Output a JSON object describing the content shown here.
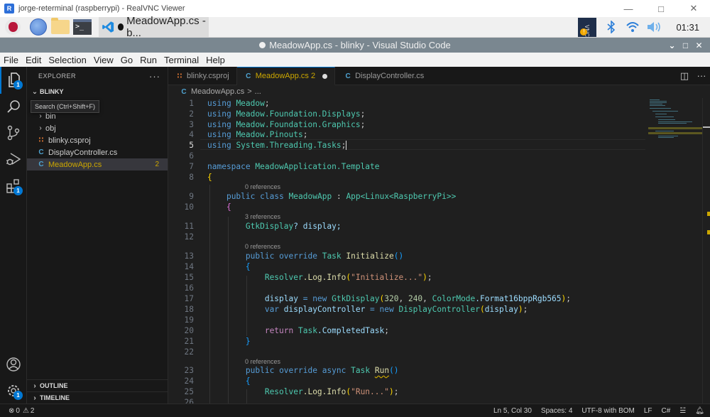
{
  "vnc_window": {
    "title": "jorge-reterminal (raspberrypi) - RealVNC Viewer",
    "controls": [
      "minimize",
      "maximize",
      "close"
    ]
  },
  "taskbar": {
    "launchers": [
      "raspberry-menu",
      "web-browser",
      "file-manager",
      "terminal"
    ],
    "task_label": "MeadowApp.cs - b...",
    "tray": {
      "vnc_label": "VNC",
      "clock": "01:31"
    }
  },
  "vscode": {
    "title": "MeadowApp.cs - blinky - Visual Studio Code",
    "menu": [
      "File",
      "Edit",
      "Selection",
      "View",
      "Go",
      "Run",
      "Terminal",
      "Help"
    ],
    "activity_bar": {
      "explorer_badge": "1",
      "extensions_badge": "1",
      "settings_badge": "1"
    },
    "tooltip": "Search (Ctrl+Shift+F)",
    "sidebar": {
      "header": "EXPLORER",
      "more": "···",
      "root": "BLINKY",
      "items": [
        {
          "label": "bin",
          "type": "folder"
        },
        {
          "label": "obj",
          "type": "folder"
        },
        {
          "label": "blinky.csproj",
          "type": "csproj"
        },
        {
          "label": "DisplayController.cs",
          "type": "cs"
        },
        {
          "label": "MeadowApp.cs",
          "type": "cs",
          "problems": "2",
          "active": true
        }
      ],
      "outline": "OUTLINE",
      "timeline": "TIMELINE"
    },
    "tabs": [
      {
        "label": "blinky.csproj",
        "active": false
      },
      {
        "label": "MeadowApp.cs",
        "problems": "2",
        "active": true,
        "modified": true
      },
      {
        "label": "DisplayController.cs",
        "active": false
      }
    ],
    "breadcrumb": {
      "file": "MeadowApp.cs",
      "sep": ">",
      "rest": "..."
    },
    "codelens": {
      "l9": "0 references",
      "l11": "3 references",
      "l13": "0 references",
      "l23": "0 references"
    },
    "line_numbers": [
      "1",
      "2",
      "3",
      "4",
      "5",
      "6",
      "7",
      "8",
      "9",
      "10",
      "11",
      "12",
      "13",
      "14",
      "15",
      "16",
      "17",
      "18",
      "19",
      "20",
      "21",
      "22",
      "23",
      "24",
      "25",
      "26"
    ],
    "code": {
      "using": "using",
      "ns1": "Meadow",
      "ns2": "Meadow.Foundation.Displays",
      "ns3": "Meadow.Foundation.Graphics",
      "ns4": "Meadow.Pinouts",
      "ns5": "System.Threading.Tasks",
      "semi": ";",
      "namespace_kw": "namespace",
      "namespace_name": "MeadowApplication.Template",
      "public": "public",
      "class": "class",
      "class_name": "MeadowApp",
      "base": "App<Linux<RaspberryPi>>",
      "colon": ":",
      "field_type": "GtkDisplay",
      "field_rest": "? display;",
      "override": "override",
      "async": "async",
      "task": "Task",
      "init": "Initialize",
      "run": "Run",
      "resolver": "Resolver",
      "log_info": ".Log.Info",
      "str_init": "\"Initialize...\"",
      "str_run": "\"Run...\"",
      "display_var": "display",
      "assign_new": " = new ",
      "gtk": "GtkDisplay",
      "n320": "320",
      "n240": "240",
      "colormode": "ColorMode",
      "format": ".Format16bppRgb565",
      "var_kw": "var",
      "dc_var": "displayController",
      "dc_type": "DisplayController",
      "return": "return",
      "completed": ".CompletedTask"
    },
    "status": {
      "errors": "0",
      "warnings": "2",
      "position": "Ln 5, Col 30",
      "spaces": "Spaces: 4",
      "encoding": "UTF-8 with BOM",
      "eol": "LF",
      "language": "C#"
    }
  }
}
